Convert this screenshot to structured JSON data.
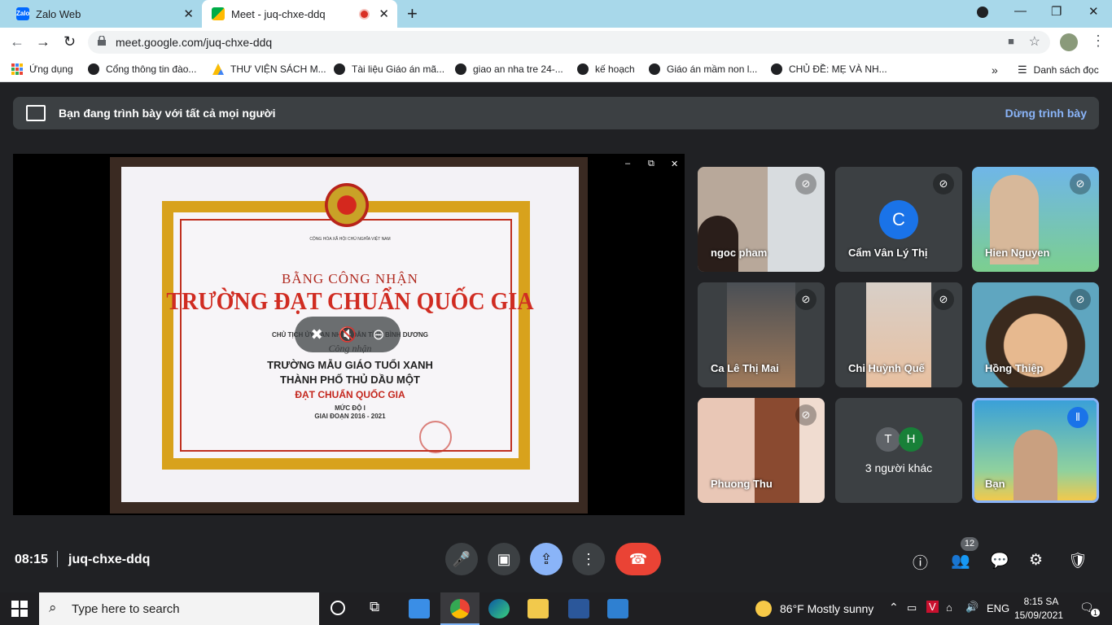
{
  "browser": {
    "tabs": [
      {
        "title": "Zalo Web",
        "favicon": "Zalo"
      },
      {
        "title": "Meet - juq-chxe-ddq"
      }
    ],
    "url": "meet.google.com/juq-chxe-ddq",
    "bookmarks": [
      "Ứng dụng",
      "Cổng thông tin đào...",
      "THƯ VIỆN SÁCH M...",
      "Tài liệu Giáo án mã...",
      "giao an nha tre 24-...",
      "kế hoạch",
      "Giáo án mầm non l...",
      "CHỦ ĐỀ: MẸ VÀ NH...",
      "Danh sách đọc"
    ]
  },
  "banner": {
    "text": "Bạn đang trình bày với tất cả mọi người",
    "stop_label": "Dừng trình bày"
  },
  "certificate": {
    "header": "CỘNG HÒA XÃ HỘI CHỦ NGHĨA VIỆT NAM",
    "title": "BẰNG CÔNG NHẬN",
    "main": "TRƯỜNG ĐẠT CHUẨN QUỐC GIA",
    "authority": "CHỦ TỊCH ỦY BAN NHÂN DÂN TỈNH BÌNH DƯƠNG",
    "line1": "Công nhận",
    "line2": "TRƯỜNG MẪU GIÁO TUỔI XANH",
    "line3": "THÀNH PHỐ THỦ DẦU MỘT",
    "line4": "ĐẠT CHUẨN QUỐC GIA",
    "line5": "MỨC ĐỘ I",
    "line6": "GIAI ĐOẠN 2016 - 2021"
  },
  "participants": [
    {
      "name": "ngoc pham"
    },
    {
      "name": "Cẩm Vân Lý Thị",
      "initial": "C"
    },
    {
      "name": "Hien Nguyen"
    },
    {
      "name": "Ca Lê Thị Mai"
    },
    {
      "name": "Chi Huỳnh Quế"
    },
    {
      "name": "Hồng Thiệp"
    },
    {
      "name": "Phuong Thu"
    },
    {
      "name": "3 người khác",
      "initials": [
        "T",
        "H"
      ]
    },
    {
      "name": "Bạn"
    }
  ],
  "meeting": {
    "time": "08:15",
    "code": "juq-chxe-ddq",
    "participant_count": "12"
  },
  "taskbar": {
    "search_placeholder": "Type here to search",
    "weather": "86°F  Mostly sunny",
    "lang": "ENG",
    "clock_time": "8:15 SA",
    "clock_date": "15/09/2021",
    "notifications": "1"
  },
  "colors": {
    "accent_blue": "#8ab4f8",
    "hangup_red": "#ea4335",
    "meet_bg": "#202124"
  }
}
